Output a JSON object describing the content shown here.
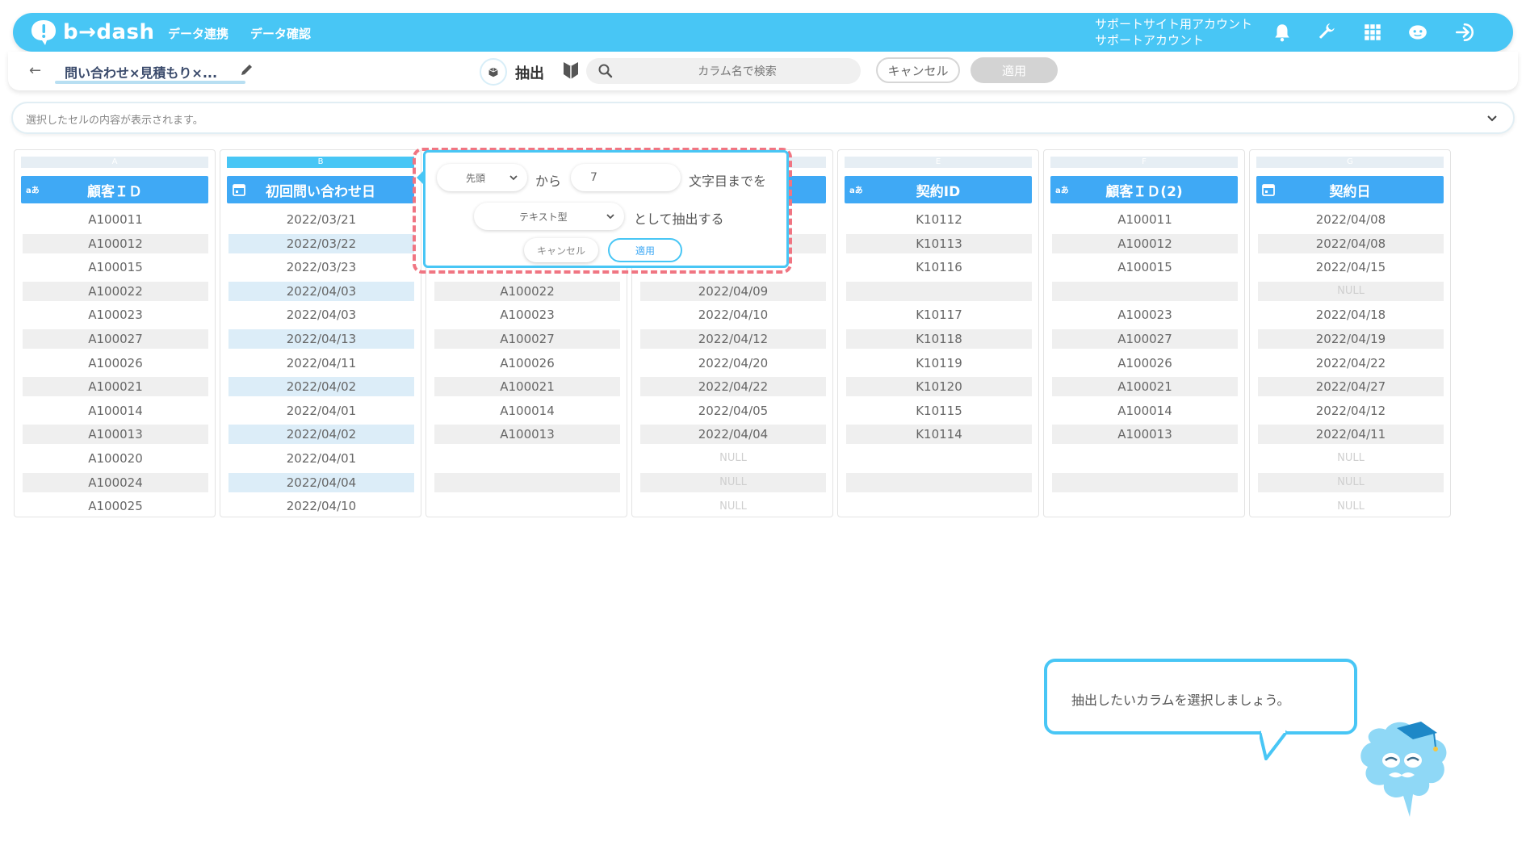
{
  "header": {
    "logo_text": "b→dash",
    "nav": [
      "データ連携",
      "データ確認"
    ],
    "account_line1": "サポートサイト用アカウント",
    "account_line2": "サポートアカウント",
    "icons": [
      "bell-icon",
      "wrench-icon",
      "apps-grid-icon",
      "chat-bot-icon",
      "logout-icon"
    ]
  },
  "subbar": {
    "back_icon": "←",
    "project_name": "問い合わせ×見積もり×...",
    "extract_label": "抽出",
    "search_placeholder": "カラム名で検索",
    "cancel_label": "キャンセル",
    "apply_label": "適用"
  },
  "cell_display": {
    "placeholder": "選択したセルの内容が表示されます。"
  },
  "columns": [
    {
      "letter": "A",
      "name": "顧客ＩＤ",
      "type": "text",
      "type_label": "aあ",
      "cells": [
        "A100011",
        "A100012",
        "A100015",
        "A100022",
        "A100023",
        "A100027",
        "A100026",
        "A100021",
        "A100014",
        "A100013",
        "A100020",
        "A100024",
        "A100025"
      ]
    },
    {
      "letter": "B",
      "name": "初回問い合わせ日",
      "type": "date",
      "type_label": "",
      "cells": [
        "2022/03/21",
        "2022/03/22",
        "2022/03/23",
        "2022/04/03",
        "2022/04/03",
        "2022/04/13",
        "2022/04/11",
        "2022/04/02",
        "2022/04/01",
        "2022/04/02",
        "2022/04/01",
        "2022/04/04",
        "2022/04/10"
      ]
    },
    {
      "letter": "",
      "name": "",
      "type": "text",
      "type_label": "",
      "cells": [
        "",
        "",
        "",
        "A100022",
        "A100023",
        "A100027",
        "A100026",
        "A100021",
        "A100014",
        "A100013",
        "",
        "",
        ""
      ]
    },
    {
      "letter": "",
      "name": "",
      "type": "date",
      "type_label": "",
      "cells": [
        "",
        "",
        "",
        "2022/04/09",
        "2022/04/10",
        "2022/04/12",
        "2022/04/20",
        "2022/04/22",
        "2022/04/05",
        "2022/04/04",
        "NULL",
        "NULL",
        "NULL"
      ]
    },
    {
      "letter": "E",
      "name": "契約ID",
      "type": "text",
      "type_label": "aあ",
      "cells": [
        "K10112",
        "K10113",
        "K10116",
        "",
        "K10117",
        "K10118",
        "K10119",
        "K10120",
        "K10115",
        "K10114",
        "",
        "",
        ""
      ]
    },
    {
      "letter": "F",
      "name": "顧客ＩＤ(2)",
      "type": "text",
      "type_label": "aあ",
      "cells": [
        "A100011",
        "A100012",
        "A100015",
        "",
        "A100023",
        "A100027",
        "A100026",
        "A100021",
        "A100014",
        "A100013",
        "",
        "",
        ""
      ]
    },
    {
      "letter": "G",
      "name": "契約日",
      "type": "date",
      "type_label": "",
      "cells": [
        "2022/04/08",
        "2022/04/08",
        "2022/04/15",
        "NULL",
        "2022/04/18",
        "2022/04/19",
        "2022/04/22",
        "2022/04/27",
        "2022/04/12",
        "2022/04/11",
        "NULL",
        "NULL",
        "NULL"
      ]
    }
  ],
  "popover": {
    "position_select": "先頭",
    "kara": "から",
    "count_value": "7",
    "moji": "文字目までを",
    "type_select": "テキスト型",
    "toshite": "として抽出する",
    "cancel_label": "キャンセル",
    "apply_label": "適用"
  },
  "guide": {
    "message": "抽出したいカラムを選択しましょう。"
  },
  "colors": {
    "brand": "#48c6f5",
    "column_header": "#3fa9f5",
    "highlight_dash": "#f07582"
  }
}
